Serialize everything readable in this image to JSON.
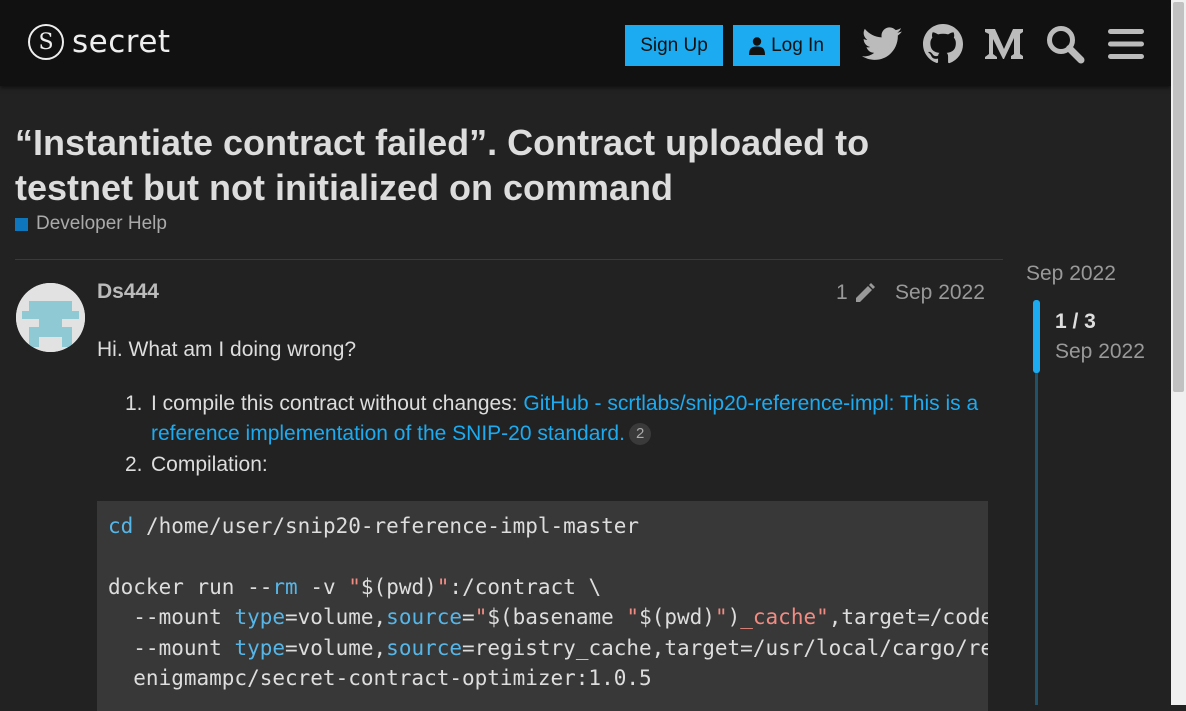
{
  "header": {
    "logo_text": "secret",
    "logo_glyph": "S",
    "signup_label": "Sign Up",
    "login_label": "Log In",
    "icons": [
      "twitter-icon",
      "github-icon",
      "medium-icon",
      "search-icon",
      "hamburger-menu-icon"
    ]
  },
  "topic": {
    "title": "“Instantiate contract failed”. Contract uploaded to testnet but not initialized on command",
    "category": "Developer Help",
    "category_color": "#0e76bd"
  },
  "post": {
    "username": "Ds444",
    "edit_count": "1",
    "date": "Sep 2022",
    "greeting": "Hi. What am I doing wrong?",
    "list": [
      {
        "num": "1.",
        "text": "I compile this contract without changes: ",
        "link": "GitHub - scrtlabs/snip20-reference-impl: This is a reference implementation of the SNIP-20 standard.",
        "badge": "2"
      },
      {
        "num": "2.",
        "text": "Compilation:"
      }
    ],
    "code_lines": [
      [
        {
          "t": "cd",
          "c": "kw"
        },
        {
          "t": " /home/user/snip20-reference-impl-master",
          "c": ""
        }
      ],
      [],
      [
        {
          "t": "docker run --",
          "c": ""
        },
        {
          "t": "rm",
          "c": "kw"
        },
        {
          "t": " -v ",
          "c": ""
        },
        {
          "t": "\"",
          "c": "str"
        },
        {
          "t": "$(pwd)",
          "c": ""
        },
        {
          "t": "\"",
          "c": "str"
        },
        {
          "t": ":/contract \\",
          "c": ""
        }
      ],
      [
        {
          "t": "  --mount ",
          "c": ""
        },
        {
          "t": "type",
          "c": "kw"
        },
        {
          "t": "=volume,",
          "c": ""
        },
        {
          "t": "source",
          "c": "kw"
        },
        {
          "t": "=",
          "c": ""
        },
        {
          "t": "\"",
          "c": "str"
        },
        {
          "t": "$(basename ",
          "c": ""
        },
        {
          "t": "\"",
          "c": "str"
        },
        {
          "t": "$(pwd)",
          "c": ""
        },
        {
          "t": "\"",
          "c": "str"
        },
        {
          "t": ")",
          "c": ""
        },
        {
          "t": "_cache\"",
          "c": "str"
        },
        {
          "t": ",target=/code/target \\",
          "c": ""
        }
      ],
      [
        {
          "t": "  --mount ",
          "c": ""
        },
        {
          "t": "type",
          "c": "kw"
        },
        {
          "t": "=volume,",
          "c": ""
        },
        {
          "t": "source",
          "c": "kw"
        },
        {
          "t": "=registry_cache,target=/usr/local/cargo/registry \\",
          "c": ""
        }
      ],
      [
        {
          "t": "  enigmampc/secret-contract-optimizer:1.0.5",
          "c": ""
        }
      ]
    ]
  },
  "timeline": {
    "top_date": "Sep 2022",
    "position": "1 / 3",
    "current_date": "Sep 2022",
    "accent": "#1cabf0"
  },
  "colors": {
    "background": "#222222",
    "header_bg": "#111111",
    "primary_button": "#1cabf0"
  }
}
